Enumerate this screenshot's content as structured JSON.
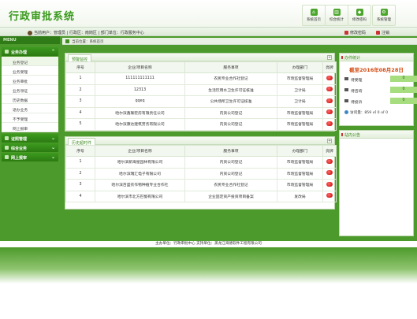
{
  "app": {
    "title": "行政审批系统"
  },
  "header_buttons": [
    {
      "label": "系统首页",
      "glyph": "⌂"
    },
    {
      "label": "综合统计",
      "glyph": "▥"
    },
    {
      "label": "修改密码",
      "glyph": "◆"
    },
    {
      "label": "系统管理",
      "glyph": "⚙"
    }
  ],
  "userbar": {
    "text": "当前用户：管理员 | 行政区：南岗区 | 部门单位：行政服务中心",
    "change_password": "修改密码",
    "logout": "注销"
  },
  "menu_label": "MENU",
  "breadcrumb": "当前位置：系统首页",
  "sidebar": {
    "sections": [
      {
        "label": "业务办理",
        "expanded": true,
        "items": [
          "业务登记",
          "业务受理",
          "业务审批",
          "业务领证",
          "历史数据",
          "退办业务",
          "不予受理",
          "网上报审"
        ]
      },
      {
        "label": "证照管理",
        "expanded": false
      },
      {
        "label": "综合业务",
        "expanded": false
      },
      {
        "label": "网上报审",
        "expanded": false
      }
    ]
  },
  "monitor_panel": {
    "tab": "预警监控",
    "headers": [
      "序号",
      "企业/项目名称",
      "服务事项",
      "办理部门",
      "亮牌"
    ],
    "rows": [
      [
        "1",
        "111111111111",
        "农民专业合作社登记",
        "市场监督管理局"
      ],
      [
        "2",
        "12313",
        "生活饮用水卫生许可证核准",
        "卫计局"
      ],
      [
        "3",
        "qqeq",
        "公共场所卫生许可证核准",
        "卫计局"
      ],
      [
        "4",
        "哈尔滨鑫联宏房有限责任公司",
        "内资公司登记",
        "市场监督管理局"
      ],
      [
        "5",
        "哈尔滨康达建筑劳务有限公司",
        "内资公司登记",
        "市场监督管理局"
      ]
    ]
  },
  "history_panel": {
    "tab": "历史超时件",
    "headers": [
      "序号",
      "企业/项目名称",
      "服务事项",
      "办理部门",
      "亮牌"
    ],
    "rows": [
      [
        "1",
        "哈尔滨新海星园林有限公司",
        "内资公司登记",
        "市场监督管理局"
      ],
      [
        "2",
        "哈尔滨瑞汇电子有限公司",
        "内资公司登记",
        "市场监督管理局"
      ],
      [
        "3",
        "哈尔滨百盛农作物种植专业合作社",
        "农民专业合作社登记",
        "市场监督管理局"
      ],
      [
        "4",
        "哈尔滨市北方巴蜀有限公司",
        "企业固定资产投资项目备案",
        "发改局"
      ]
    ]
  },
  "stats_panel": {
    "title": "办件统计",
    "date": "截至2016年08月28日",
    "rows": [
      {
        "label": "待受理",
        "value": "0",
        "unit": "件"
      },
      {
        "label": "待咨询",
        "value": "0",
        "unit": "件"
      },
      {
        "label": "待投诉",
        "value": "0",
        "unit": "件"
      }
    ],
    "visits": "访问量：859 ㎡  0  ㎡  0"
  },
  "announce_panel": {
    "title": "站内公告"
  },
  "footer": "主办单位：行政审批中心  支持单位：黑龙江海德软件工程有限公司"
}
